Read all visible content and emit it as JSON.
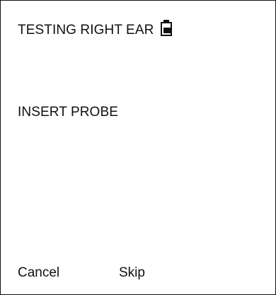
{
  "header": {
    "title": "TESTING RIGHT EAR",
    "battery_icon": "battery-icon",
    "battery_level": 0.5
  },
  "main": {
    "instruction": "INSERT PROBE"
  },
  "softkeys": {
    "cancel_label": "Cancel",
    "skip_label": "Skip"
  },
  "colors": {
    "background": "#ffffff",
    "text": "#111111",
    "border": "#111111"
  }
}
